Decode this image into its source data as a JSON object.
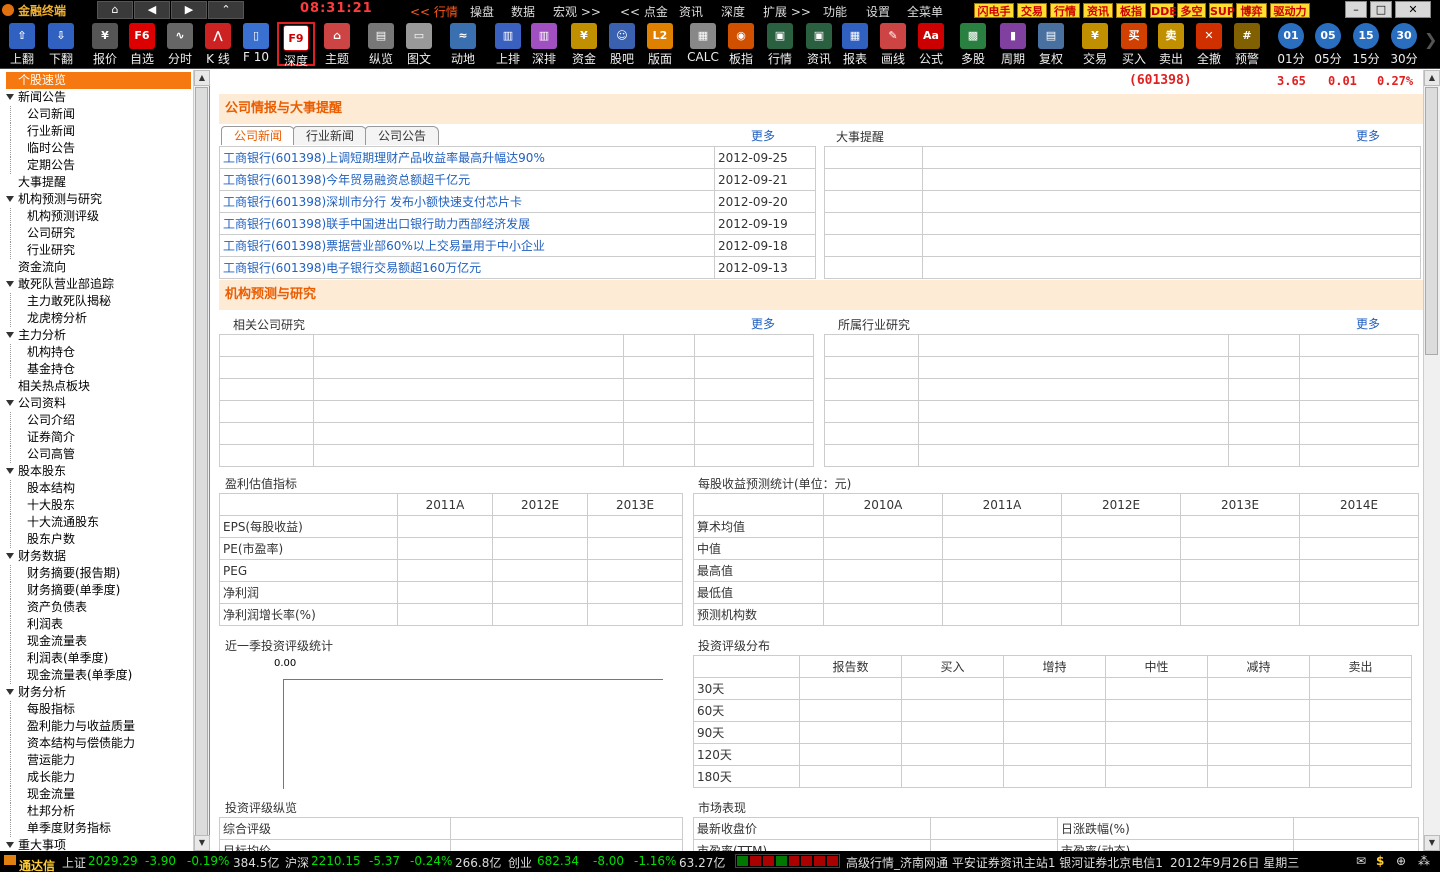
{
  "menubar": {
    "app_name": "金融终端",
    "clock": "08:31:21",
    "menu": [
      "<< 行情",
      "操盘",
      "数据",
      "宏观 >>",
      "<< 点金",
      "资讯",
      "深度",
      "扩展 >>",
      "功能",
      "设置",
      "全菜单"
    ],
    "badges": [
      "闪电手",
      "交易",
      "行情",
      "资讯",
      "板指",
      "DDE",
      "多空",
      "SUP",
      "博弈",
      "驱动力"
    ]
  },
  "toolbar": {
    "buttons": [
      {
        "label": "上翻",
        "icon": "arrow-up-icon",
        "glyph": "⇧"
      },
      {
        "label": "下翻",
        "icon": "arrow-down-icon",
        "glyph": "⇩"
      },
      {
        "label": "报价",
        "icon": "price-icon",
        "glyph": "¥"
      },
      {
        "label": "自选",
        "icon": "f6-icon",
        "glyph": "F6"
      },
      {
        "label": "分时",
        "icon": "timeshare-icon",
        "glyph": "∿"
      },
      {
        "label": "K 线",
        "icon": "kline-icon",
        "glyph": "⋀"
      },
      {
        "label": "F 10",
        "icon": "f10-icon",
        "glyph": "▯"
      },
      {
        "label": "深度",
        "icon": "f9-icon",
        "glyph": "F9"
      },
      {
        "label": "主题",
        "icon": "home-icon",
        "glyph": "⌂"
      },
      {
        "label": "纵览",
        "icon": "overview-icon",
        "glyph": "▤"
      },
      {
        "label": "图文",
        "icon": "graphic-icon",
        "glyph": "▭"
      },
      {
        "label": "动地",
        "icon": "motion-icon",
        "glyph": "≈"
      },
      {
        "label": "上排",
        "icon": "rank-up-icon",
        "glyph": "▥"
      },
      {
        "label": "深排",
        "icon": "rank-sz-icon",
        "glyph": "▥"
      },
      {
        "label": "资金",
        "icon": "capital-icon",
        "glyph": "¥"
      },
      {
        "label": "股吧",
        "icon": "forum-icon",
        "glyph": "☺"
      },
      {
        "label": "版面",
        "icon": "l2-icon",
        "glyph": "L2"
      },
      {
        "label": "CALC",
        "icon": "calculator-icon",
        "glyph": "▦"
      },
      {
        "label": "板指",
        "icon": "sector-icon",
        "glyph": "◉"
      },
      {
        "label": "行情",
        "icon": "market-icon",
        "glyph": "▣"
      },
      {
        "label": "资讯",
        "icon": "news-icon",
        "glyph": "▣"
      },
      {
        "label": "报表",
        "icon": "report-icon",
        "glyph": "▦"
      },
      {
        "label": "画线",
        "icon": "draw-line-icon",
        "glyph": "✎"
      },
      {
        "label": "公式",
        "icon": "formula-icon",
        "glyph": "Aa"
      },
      {
        "label": "多股",
        "icon": "multi-stock-icon",
        "glyph": "▩"
      },
      {
        "label": "周期",
        "icon": "period-icon",
        "glyph": "▮"
      },
      {
        "label": "复权",
        "icon": "restore-rights-icon",
        "glyph": "▤"
      },
      {
        "label": "交易",
        "icon": "trade-icon",
        "glyph": "¥"
      },
      {
        "label": "买入",
        "icon": "buy-icon",
        "glyph": "买"
      },
      {
        "label": "卖出",
        "icon": "sell-icon",
        "glyph": "卖"
      },
      {
        "label": "全撤",
        "icon": "cancel-all-icon",
        "glyph": "✕"
      },
      {
        "label": "预警",
        "icon": "alert-icon",
        "glyph": "#"
      },
      {
        "label": "01分",
        "icon": "min01-icon",
        "glyph": "01"
      },
      {
        "label": "05分",
        "icon": "min05-icon",
        "glyph": "05"
      },
      {
        "label": "15分",
        "icon": "min15-icon",
        "glyph": "15"
      },
      {
        "label": "30分",
        "icon": "min30-icon",
        "glyph": "30"
      }
    ]
  },
  "tree": [
    {
      "label": "个股速览",
      "level": 0,
      "type": "selected"
    },
    {
      "label": "新闻公告",
      "level": 0,
      "type": "group"
    },
    {
      "label": "公司新闻",
      "level": 1
    },
    {
      "label": "行业新闻",
      "level": 1
    },
    {
      "label": "临时公告",
      "level": 1
    },
    {
      "label": "定期公告",
      "level": 1
    },
    {
      "label": "大事提醒",
      "level": 0,
      "type": "leaf"
    },
    {
      "label": "机构预测与研究",
      "level": 0,
      "type": "group"
    },
    {
      "label": "机构预测评级",
      "level": 1
    },
    {
      "label": "公司研究",
      "level": 1
    },
    {
      "label": "行业研究",
      "level": 1
    },
    {
      "label": "资金流向",
      "level": 0,
      "type": "leaf"
    },
    {
      "label": "敢死队营业部追踪",
      "level": 0,
      "type": "group"
    },
    {
      "label": "主力敢死队揭秘",
      "level": 1
    },
    {
      "label": "龙虎榜分析",
      "level": 1
    },
    {
      "label": "主力分析",
      "level": 0,
      "type": "group"
    },
    {
      "label": "机构持仓",
      "level": 1
    },
    {
      "label": "基金持仓",
      "level": 1
    },
    {
      "label": "相关热点板块",
      "level": 0,
      "type": "leaf"
    },
    {
      "label": "公司资料",
      "level": 0,
      "type": "group"
    },
    {
      "label": "公司介绍",
      "level": 1
    },
    {
      "label": "证券简介",
      "level": 1
    },
    {
      "label": "公司高管",
      "level": 1
    },
    {
      "label": "股本股东",
      "level": 0,
      "type": "group"
    },
    {
      "label": "股本结构",
      "level": 1
    },
    {
      "label": "十大股东",
      "level": 1
    },
    {
      "label": "十大流通股东",
      "level": 1
    },
    {
      "label": "股东户数",
      "level": 1
    },
    {
      "label": "财务数据",
      "level": 0,
      "type": "group"
    },
    {
      "label": "财务摘要(报告期)",
      "level": 1
    },
    {
      "label": "财务摘要(单季度)",
      "level": 1
    },
    {
      "label": "资产负债表",
      "level": 1
    },
    {
      "label": "利润表",
      "level": 1
    },
    {
      "label": "现金流量表",
      "level": 1
    },
    {
      "label": "利润表(单季度)",
      "level": 1
    },
    {
      "label": "现金流量表(单季度)",
      "level": 1
    },
    {
      "label": "财务分析",
      "level": 0,
      "type": "group"
    },
    {
      "label": "每股指标",
      "level": 1
    },
    {
      "label": "盈利能力与收益质量",
      "level": 1
    },
    {
      "label": "资本结构与偿债能力",
      "level": 1
    },
    {
      "label": "营运能力",
      "level": 1
    },
    {
      "label": "成长能力",
      "level": 1
    },
    {
      "label": "现金流量",
      "level": 1
    },
    {
      "label": "杜邦分析",
      "level": 1
    },
    {
      "label": "单季度财务指标",
      "level": 1
    },
    {
      "label": "重大事项",
      "level": 0,
      "type": "group"
    }
  ],
  "quote": {
    "code": "(601398)",
    "price": "3.65",
    "change": "0.01",
    "pct": "0.27%"
  },
  "section1": {
    "title": "公司情报与大事提醒",
    "tabs": [
      "公司新闻",
      "行业新闻",
      "公司公告"
    ],
    "more": "更多",
    "events_label": "大事提醒",
    "events_more": "更多",
    "news": [
      {
        "title": "工商银行(601398)上调短期理财产品收益率最高升幅达90%",
        "date": "2012-09-25"
      },
      {
        "title": "工商银行(601398)今年贸易融资总额超千亿元",
        "date": "2012-09-21"
      },
      {
        "title": "工商银行(601398)深圳市分行 发布小额快速支付芯片卡",
        "date": "2012-09-20"
      },
      {
        "title": "工商银行(601398)联手中国进出口银行助力西部经济发展",
        "date": "2012-09-19"
      },
      {
        "title": "工商银行(601398)票据营业部60%以上交易量用于中小企业",
        "date": "2012-09-18"
      },
      {
        "title": "工商银行(601398)电子银行交易额超160万亿元",
        "date": "2012-09-13"
      }
    ]
  },
  "section2": {
    "title": "机构预测与研究",
    "company_research": "相关公司研究",
    "industry_research": "所属行业研究",
    "more": "更多"
  },
  "valuation": {
    "title": "盈利估值指标",
    "headers": [
      "",
      "2011A",
      "2012E",
      "2013E"
    ],
    "rows": [
      "EPS(每股收益)",
      "PE(市盈率)",
      "PEG",
      "净利润",
      "净利润增长率(%)"
    ]
  },
  "eps_forecast": {
    "title": "每股收益预测统计(单位：元)",
    "headers": [
      "",
      "2010A",
      "2011A",
      "2012E",
      "2013E",
      "2014E"
    ],
    "rows": [
      "算术均值",
      "中值",
      "最高值",
      "最低值",
      "预测机构数"
    ]
  },
  "rating_stats": {
    "title": "近一季投资评级统计",
    "value": "0.00"
  },
  "rating_dist": {
    "title": "投资评级分布",
    "headers": [
      "",
      "报告数",
      "买入",
      "增持",
      "中性",
      "减持",
      "卖出"
    ],
    "rows": [
      "30天",
      "60天",
      "90天",
      "120天",
      "180天"
    ]
  },
  "rating_overview": {
    "title": "投资评级纵览",
    "rows": [
      "综合评级",
      "目标均价"
    ]
  },
  "market_perf": {
    "title": "市场表现",
    "rows": [
      [
        "最新收盘价",
        "日涨跌幅(%)"
      ],
      [
        "市盈率(TTM)",
        "市盈率(动态)"
      ]
    ]
  },
  "status": {
    "brand": "通达信",
    "sh_label": "上证",
    "sh_val": "2029.29",
    "sh_chg": "-3.90",
    "sh_pct": "-0.19%",
    "sh_amt": "384.5亿",
    "hs_label": "沪深",
    "hs_val": "2210.15",
    "hs_chg": "-5.37",
    "hs_pct": "-0.24%",
    "hs_amt": "266.8亿",
    "cy_label": "创业",
    "cy_val": "682.34",
    "cy_chg": "-8.00",
    "cy_pct": "-1.16%",
    "cy_amt": "63.27亿",
    "servers": "高级行情_济南网通  平安证券资讯主站1  银河证券北京电信1",
    "date": "2012年9月26日  星期三"
  }
}
